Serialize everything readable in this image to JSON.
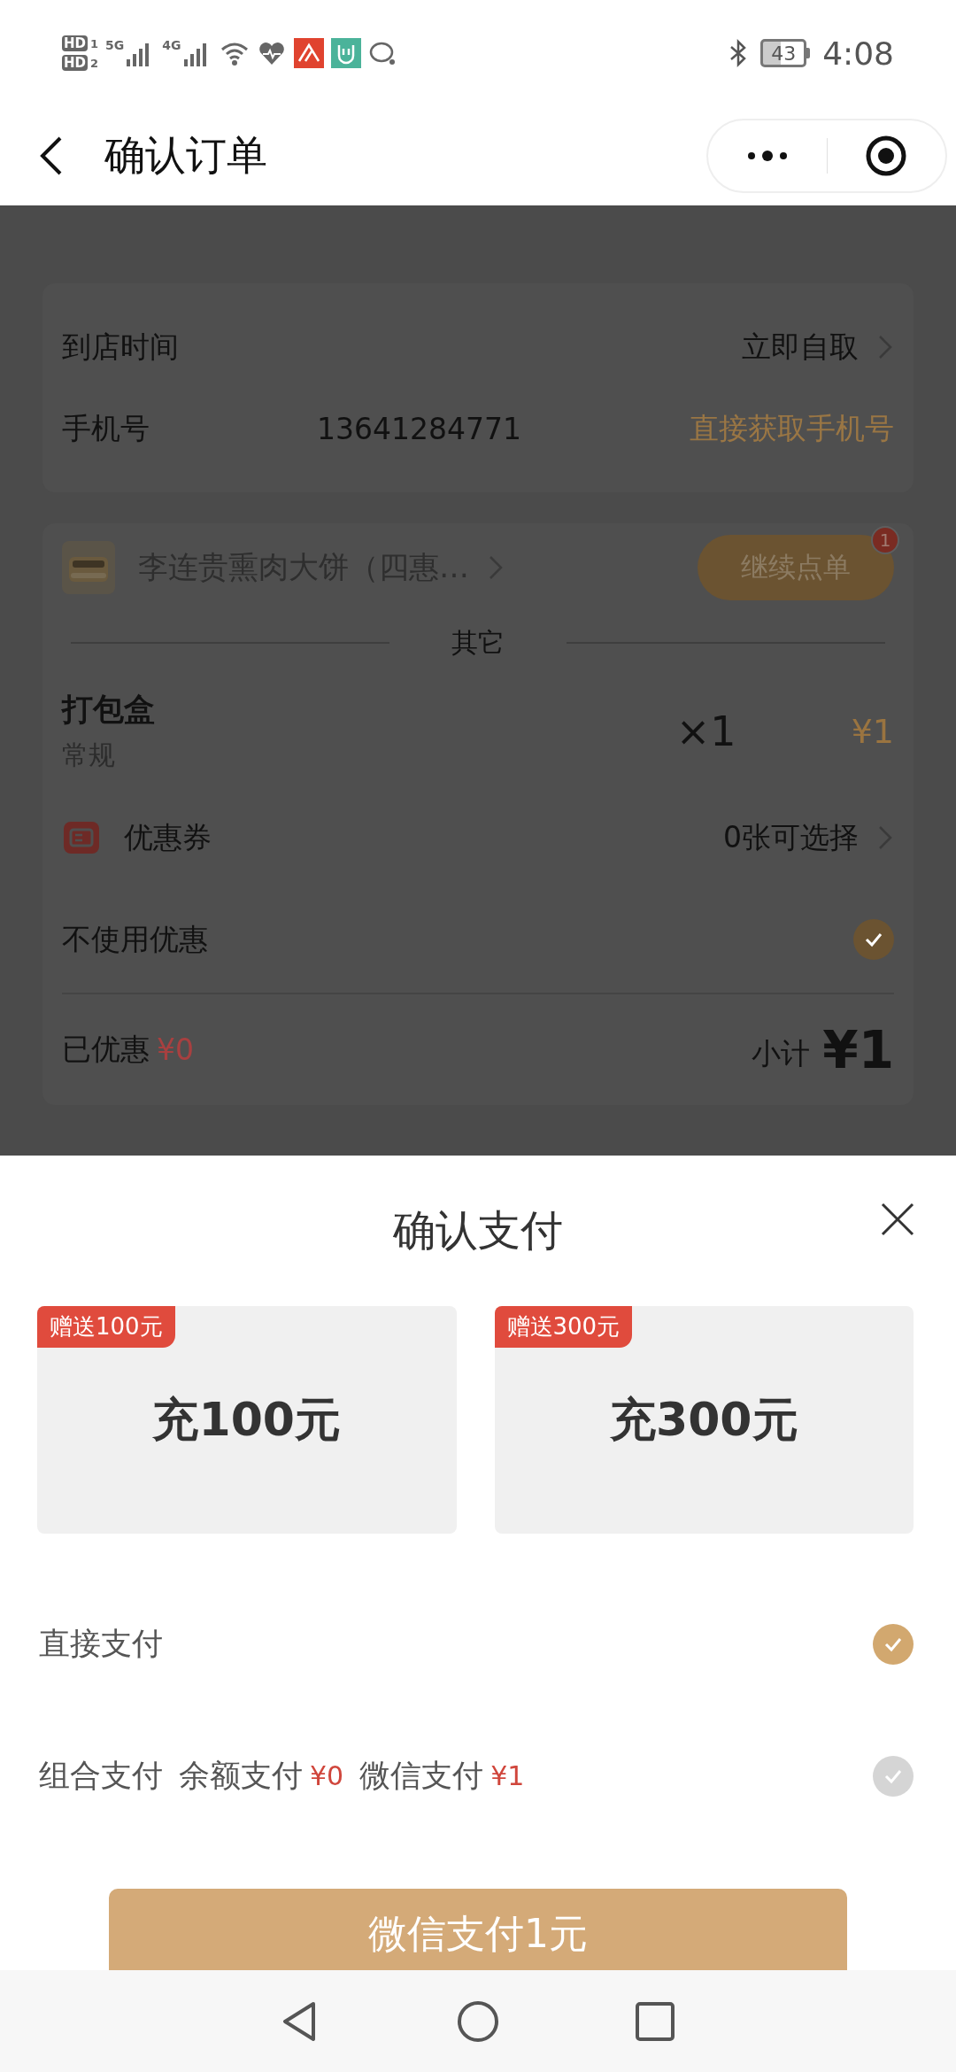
{
  "status_bar": {
    "sim_badges": [
      {
        "label": "HD",
        "slot": "1"
      },
      {
        "label": "HD",
        "slot": "2"
      }
    ],
    "networks": [
      "5G",
      "4G"
    ],
    "battery": "43",
    "time": "4:08"
  },
  "header": {
    "title": "确认订单"
  },
  "pickup_card": {
    "rows": [
      {
        "kind": "link",
        "label": "到店时间",
        "value": "立即自取"
      },
      {
        "kind": "phone",
        "label": "手机号",
        "value": "13641284771",
        "action": "直接获取手机号"
      }
    ]
  },
  "order_card": {
    "store": {
      "name": "李连贵熏肉大饼（四惠…",
      "button": "继续点单",
      "badge": "1"
    },
    "section_title": "其它",
    "items": [
      {
        "name": "打包盒",
        "spec": "常规",
        "quantity": "×1",
        "price": "¥1"
      }
    ],
    "coupon": {
      "label": "优惠券",
      "value": "0张可选择"
    },
    "no_discount": {
      "label": "不使用优惠",
      "checked": true
    },
    "discounted": {
      "label": "已优惠",
      "amount": "¥0"
    },
    "subtotal": {
      "label": "小计",
      "amount": "¥1"
    }
  },
  "payment_sheet": {
    "title": "确认支付",
    "recharge_options": [
      {
        "bonus": "赠送100元",
        "label": "充100元"
      },
      {
        "bonus": "赠送300元",
        "label": "充300元"
      }
    ],
    "methods": [
      {
        "kind": "direct",
        "label": "直接支付",
        "selected": true
      },
      {
        "kind": "combined",
        "label": "组合支付",
        "parts": [
          {
            "label": "余额支付",
            "amount": "¥0"
          },
          {
            "label": "微信支付",
            "amount": "¥1"
          }
        ],
        "selected": false
      }
    ],
    "pay_button": "微信支付1元"
  }
}
